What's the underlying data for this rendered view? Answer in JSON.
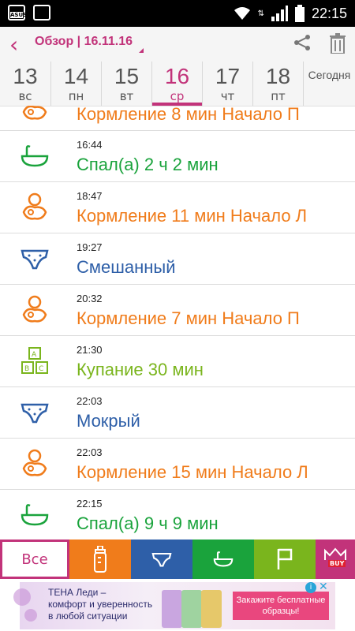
{
  "status_bar": {
    "time": "22:15"
  },
  "header": {
    "title": "Обзор | 16.11.16"
  },
  "days": [
    {
      "num": "13",
      "wd": "вс"
    },
    {
      "num": "14",
      "wd": "пн"
    },
    {
      "num": "15",
      "wd": "вт"
    },
    {
      "num": "16",
      "wd": "ср",
      "active": true
    },
    {
      "num": "17",
      "wd": "чт"
    },
    {
      "num": "18",
      "wd": "пт"
    }
  ],
  "today_label": "Сегодня",
  "entries": [
    {
      "time": "",
      "text": "Кормление  8 мин Начало П",
      "icon": "feeding-icon",
      "color": "orange"
    },
    {
      "time": "16:44",
      "text": "Спал(а) 2 ч 2 мин",
      "icon": "sleep-icon",
      "color": "green"
    },
    {
      "time": "18:47",
      "text": "Кормление  11 мин Начало Л",
      "icon": "feeding-icon",
      "color": "orange"
    },
    {
      "time": "19:27",
      "text": "Смешанный",
      "icon": "diaper-icon",
      "color": "blue"
    },
    {
      "time": "20:32",
      "text": "Кормление  7 мин Начало П",
      "icon": "feeding-icon",
      "color": "orange"
    },
    {
      "time": "21:30",
      "text": "Купание   30 мин",
      "icon": "bath-blocks-icon",
      "color": "lime"
    },
    {
      "time": "22:03",
      "text": "Мокрый",
      "icon": "diaper-icon",
      "color": "blue"
    },
    {
      "time": "22:03",
      "text": "Кормление  15 мин Начало Л",
      "icon": "feeding-icon",
      "color": "orange"
    },
    {
      "time": "22:15",
      "text": "Спал(а) 9 ч 9 мин",
      "icon": "sleep-icon",
      "color": "green"
    }
  ],
  "tabs": {
    "all_label": "Все",
    "buy_label": "BUY"
  },
  "ad": {
    "line1": "ТЕНА Леди –",
    "line2": "комфорт и уверенность",
    "line3": "в любой ситуации",
    "button": "Закажите бесплатные образцы!",
    "info": "i",
    "close": "✕"
  },
  "colors": {
    "accent": "#c2337a",
    "feeding": "#f07c1b",
    "sleep": "#1aa33c",
    "diaper": "#2e5fa8",
    "activity": "#7ab51d"
  }
}
